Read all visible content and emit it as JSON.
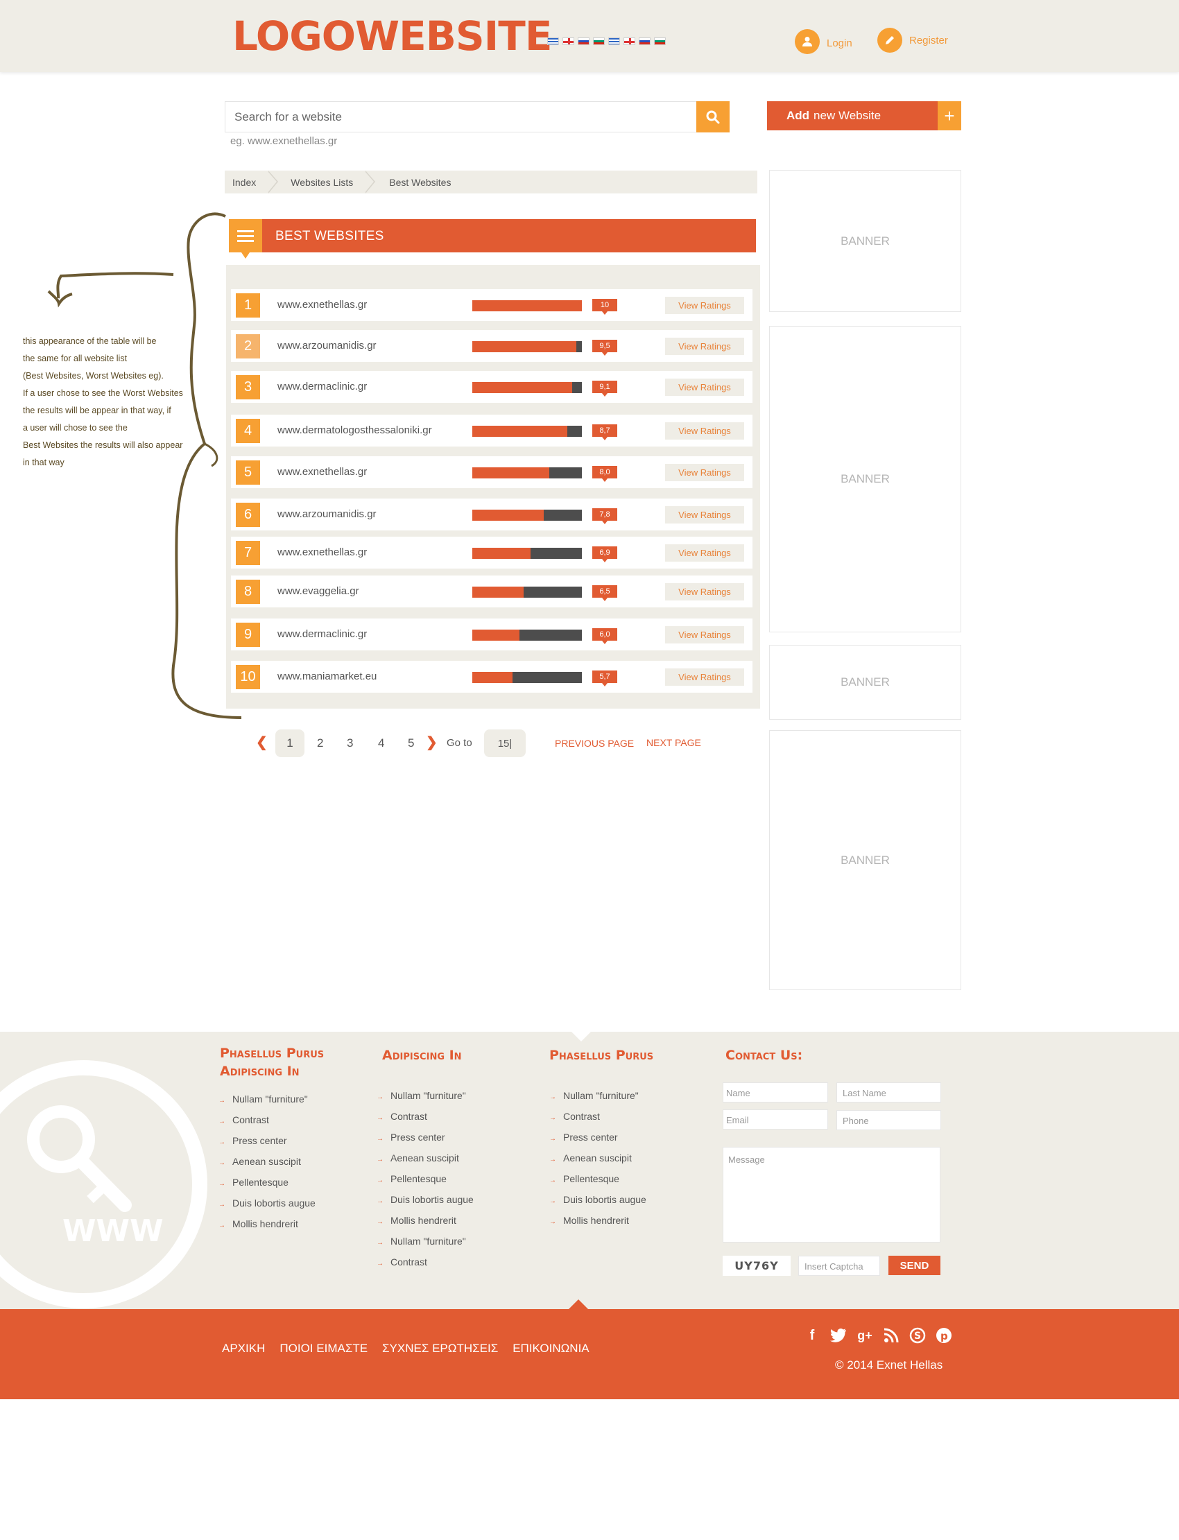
{
  "header": {
    "logo_part1": "LOGO",
    "logo_part2": "WEBSITE",
    "languages": [
      "gr",
      "uk",
      "ru",
      "bg",
      "gr",
      "uk",
      "ru",
      "bg"
    ],
    "login_label": "Login",
    "register_label": "Register"
  },
  "search": {
    "placeholder": "Search for a website",
    "hint": "eg. www.exnethellas.gr",
    "add_bold": "Add",
    "add_rest": "new Website",
    "add_plus": "+"
  },
  "breadcrumb": [
    "Index",
    "Websites Lists",
    "Best Websites"
  ],
  "list": {
    "title": "BEST WEBSITES",
    "view_label": "View Ratings",
    "rows": [
      {
        "rank": "1",
        "site": "www.exnethellas.gr",
        "score": "10",
        "rating": 10
      },
      {
        "rank": "2",
        "site": "www.arzoumanidis.gr",
        "score": "9,5",
        "rating": 9.5
      },
      {
        "rank": "3",
        "site": "www.dermaclinic.gr",
        "score": "9,1",
        "rating": 9.1
      },
      {
        "rank": "4",
        "site": "www.dermatologosthessaloniki.gr",
        "score": "8,7",
        "rating": 8.7
      },
      {
        "rank": "5",
        "site": "www.exnethellas.gr",
        "score": "8,0",
        "rating": 7.0
      },
      {
        "rank": "6",
        "site": "www.arzoumanidis.gr",
        "score": "7,8",
        "rating": 6.5
      },
      {
        "rank": "7",
        "site": "www.exnethellas.gr",
        "score": "6,9",
        "rating": 5.3
      },
      {
        "rank": "8",
        "site": "www.evaggelia.gr",
        "score": "6,5",
        "rating": 4.7
      },
      {
        "rank": "9",
        "site": "www.dermaclinic.gr",
        "score": "6,0",
        "rating": 4.3
      },
      {
        "rank": "10",
        "site": "www.maniamarket.eu",
        "score": "5,7",
        "rating": 3.7
      }
    ]
  },
  "pagination": {
    "pages": [
      "1",
      "2",
      "3",
      "4",
      "5"
    ],
    "active": "1",
    "goto_label": "Go to",
    "goto_value": "15|",
    "prev": "PREVIOUS PAGE",
    "next": "NEXT PAGE"
  },
  "banner_label": "BANNER",
  "annotation": [
    "this appearance of the table will be",
    " the same for all website list",
    "(Best Websites, Worst Websites eg).",
    "If a user chose to see the Worst Websites",
    "the results will be appear in that way, if",
    "a user will chose to see the",
    "Best Websites the results will also appear",
    "in that way"
  ],
  "footer": {
    "www_text": "WWW",
    "col1": {
      "title1": "Phasellus Purus",
      "title2": "Adipiscing In",
      "links": [
        "Nullam \"furniture\"",
        "Contrast",
        "Press center",
        "Aenean suscipit",
        "Pellentesque",
        "Duis lobortis augue",
        "Mollis hendrerit"
      ]
    },
    "col2": {
      "title": "Adipiscing In",
      "links": [
        "Nullam \"furniture\"",
        "Contrast",
        "Press center",
        "Aenean suscipit",
        "Pellentesque",
        "Duis lobortis augue",
        "Mollis hendrerit",
        "Nullam \"furniture\"",
        "Contrast"
      ]
    },
    "col3": {
      "title": "Phasellus Purus",
      "links": [
        "Nullam \"furniture\"",
        "Contrast",
        "Press center",
        "Aenean suscipit",
        "Pellentesque",
        "Duis lobortis augue",
        "Mollis hendrerit"
      ]
    },
    "contact": {
      "title": "Contact Us:",
      "name": "Name",
      "last_name": "Last Name",
      "email": "Email",
      "phone": "Phone",
      "message": "Message",
      "captcha_code": "UY76Y",
      "captcha_placeholder": "Insert Captcha",
      "send": "SEND"
    },
    "nav": [
      "ΑΡΧΙΚΗ",
      "ΠΟΙΟΙ ΕΙΜΑΣΤΕ",
      "ΣΥΧΝΕΣ ΕΡΩΤΗΣΕΙΣ",
      "ΕΠΙΚΟΙΝΩΝΙΑ"
    ],
    "social": [
      "facebook-icon",
      "twitter-icon",
      "google-plus-icon",
      "rss-icon",
      "skype-icon",
      "pinterest-icon"
    ],
    "copyright": "© 2014 Exnet Hellas"
  },
  "colors": {
    "accent": "#e15b32",
    "secondary": "#f7a033",
    "panel": "#efede6",
    "bar_dark": "#4d4d4d"
  }
}
